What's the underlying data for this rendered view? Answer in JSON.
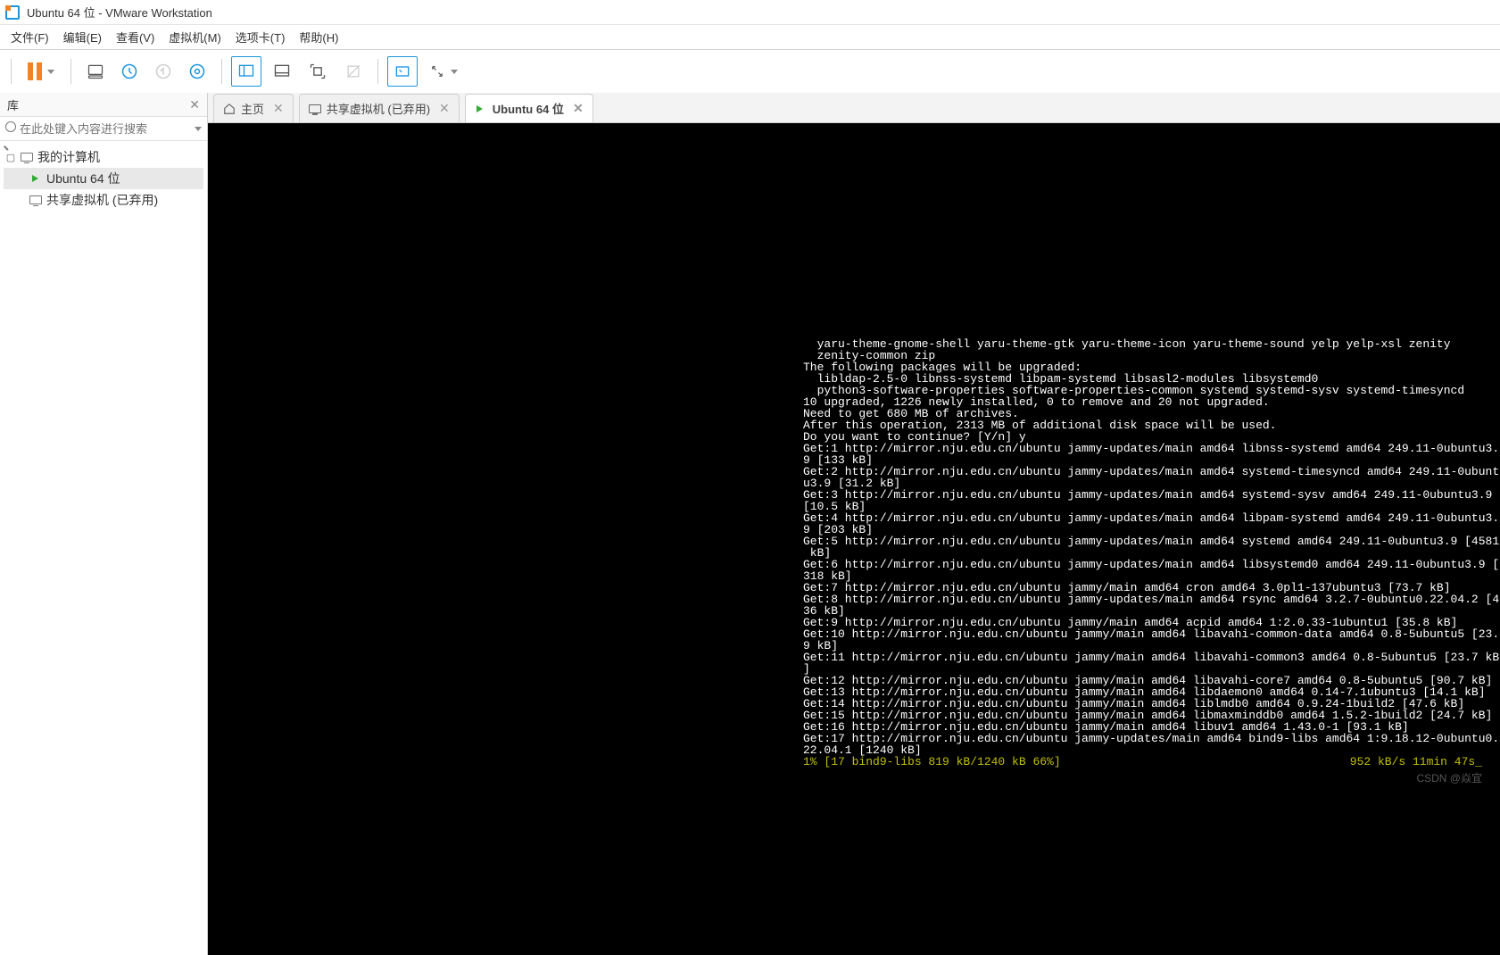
{
  "window": {
    "title": "Ubuntu 64 位 - VMware Workstation"
  },
  "menu": {
    "file": "文件(F)",
    "edit": "编辑(E)",
    "view": "查看(V)",
    "vm": "虚拟机(M)",
    "tabs": "选项卡(T)",
    "help": "帮助(H)"
  },
  "sidebar": {
    "header": "库",
    "search_placeholder": "在此处键入内容进行搜索",
    "root": "我的计算机",
    "items": [
      {
        "label": "Ubuntu 64 位",
        "selected": true,
        "running": true
      },
      {
        "label": "共享虚拟机 (已弃用)",
        "selected": false,
        "running": false
      }
    ]
  },
  "tabs": [
    {
      "label": "主页",
      "icon": "home"
    },
    {
      "label": "共享虚拟机 (已弃用)",
      "icon": "monitor"
    },
    {
      "label": "Ubuntu 64 位",
      "icon": "running",
      "active": true
    }
  ],
  "terminal": {
    "lines": [
      "  yaru-theme-gnome-shell yaru-theme-gtk yaru-theme-icon yaru-theme-sound yelp yelp-xsl zenity",
      "  zenity-common zip",
      "The following packages will be upgraded:",
      "  libldap-2.5-0 libnss-systemd libpam-systemd libsasl2-modules libsystemd0",
      "  python3-software-properties software-properties-common systemd systemd-sysv systemd-timesyncd",
      "10 upgraded, 1226 newly installed, 0 to remove and 20 not upgraded.",
      "Need to get 680 MB of archives.",
      "After this operation, 2313 MB of additional disk space will be used.",
      "Do you want to continue? [Y/n] y",
      "Get:1 http://mirror.nju.edu.cn/ubuntu jammy-updates/main amd64 libnss-systemd amd64 249.11-0ubuntu3.",
      "9 [133 kB]",
      "Get:2 http://mirror.nju.edu.cn/ubuntu jammy-updates/main amd64 systemd-timesyncd amd64 249.11-0ubunt",
      "u3.9 [31.2 kB]",
      "Get:3 http://mirror.nju.edu.cn/ubuntu jammy-updates/main amd64 systemd-sysv amd64 249.11-0ubuntu3.9 ",
      "[10.5 kB]",
      "Get:4 http://mirror.nju.edu.cn/ubuntu jammy-updates/main amd64 libpam-systemd amd64 249.11-0ubuntu3.",
      "9 [203 kB]",
      "Get:5 http://mirror.nju.edu.cn/ubuntu jammy-updates/main amd64 systemd amd64 249.11-0ubuntu3.9 [4581",
      " kB]",
      "Get:6 http://mirror.nju.edu.cn/ubuntu jammy-updates/main amd64 libsystemd0 amd64 249.11-0ubuntu3.9 [",
      "318 kB]",
      "Get:7 http://mirror.nju.edu.cn/ubuntu jammy/main amd64 cron amd64 3.0pl1-137ubuntu3 [73.7 kB]",
      "Get:8 http://mirror.nju.edu.cn/ubuntu jammy-updates/main amd64 rsync amd64 3.2.7-0ubuntu0.22.04.2 [4",
      "36 kB]",
      "Get:9 http://mirror.nju.edu.cn/ubuntu jammy/main amd64 acpid amd64 1:2.0.33-1ubuntu1 [35.8 kB]",
      "Get:10 http://mirror.nju.edu.cn/ubuntu jammy/main amd64 libavahi-common-data amd64 0.8-5ubuntu5 [23.",
      "9 kB]",
      "Get:11 http://mirror.nju.edu.cn/ubuntu jammy/main amd64 libavahi-common3 amd64 0.8-5ubuntu5 [23.7 kB",
      "]",
      "Get:12 http://mirror.nju.edu.cn/ubuntu jammy/main amd64 libavahi-core7 amd64 0.8-5ubuntu5 [90.7 kB]",
      "Get:13 http://mirror.nju.edu.cn/ubuntu jammy/main amd64 libdaemon0 amd64 0.14-7.1ubuntu3 [14.1 kB]",
      "Get:14 http://mirror.nju.edu.cn/ubuntu jammy/main amd64 liblmdb0 amd64 0.9.24-1build2 [47.6 kB]",
      "Get:15 http://mirror.nju.edu.cn/ubuntu jammy/main amd64 libmaxminddb0 amd64 1.5.2-1build2 [24.7 kB]",
      "Get:16 http://mirror.nju.edu.cn/ubuntu jammy/main amd64 libuv1 amd64 1.43.0-1 [93.1 kB]",
      "Get:17 http://mirror.nju.edu.cn/ubuntu jammy-updates/main amd64 bind9-libs amd64 1:9.18.12-0ubuntu0.",
      "22.04.1 [1240 kB]"
    ],
    "status_left": "1% [17 bind9-libs 819 kB/1240 kB 66%]",
    "status_right": "952 kB/s 11min 47s_"
  },
  "watermark": "CSDN @焱宜"
}
